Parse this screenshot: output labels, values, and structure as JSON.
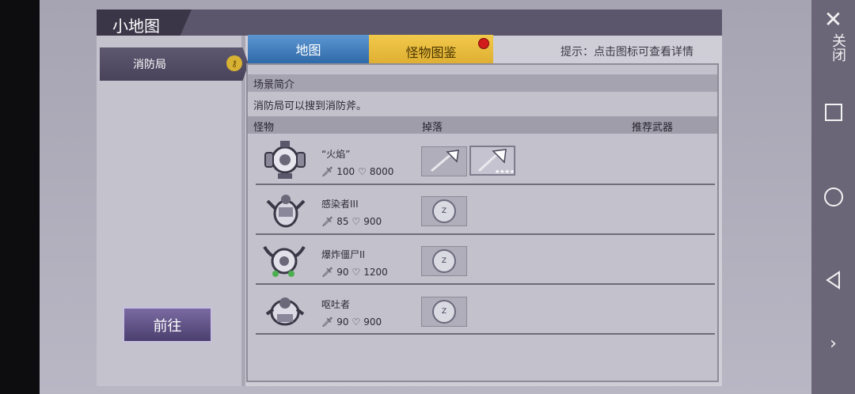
{
  "title": "小地图",
  "location": {
    "name": "消防局",
    "badge_icon": "key-icon"
  },
  "go_button": "前往",
  "tabs": [
    {
      "label": "地图"
    },
    {
      "label": "怪物图鉴",
      "active": true
    }
  ],
  "hint": "提示：点击图标可查看详情",
  "scene": {
    "title": "场景简介",
    "description": "消防局可以搜到消防斧。"
  },
  "columns": {
    "monster": "怪物",
    "drop": "掉落",
    "weapon": "推荐武器"
  },
  "monsters": [
    {
      "name": "“火焰”",
      "attack": "100",
      "hp": "8000",
      "drops": [
        "axe-icon",
        "axe-icon"
      ],
      "selected_drop": 1
    },
    {
      "name": "感染者III",
      "attack": "85",
      "hp": "900",
      "drops": [
        "coin-icon"
      ]
    },
    {
      "name": "爆炸僵尸II",
      "attack": "90",
      "hp": "1200",
      "drops": [
        "coin-icon"
      ]
    },
    {
      "name": "呕吐者",
      "attack": "90",
      "hp": "900",
      "drops": [
        "coin-icon"
      ]
    }
  ],
  "coin_text": "Z",
  "nav": {
    "close_label": "关闭"
  },
  "colors": {
    "tab_map": "#2f6aa8",
    "tab_monster": "#d8a72a",
    "notify_dot": "#d21c1c"
  }
}
